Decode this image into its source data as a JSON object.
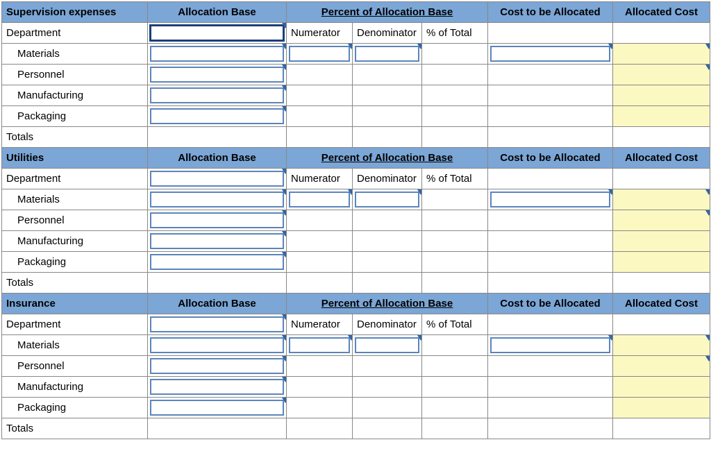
{
  "headers": {
    "allocation_base": "Allocation Base",
    "percent_alloc_base": "Percent of Allocation Base",
    "cost_to_be_allocated": "Cost to be Allocated",
    "allocated_cost": "Allocated Cost"
  },
  "sub_headers": {
    "department": "Department",
    "numerator": "Numerator",
    "denominator": "Denominator",
    "pct_of_total": "% of Total"
  },
  "row_labels": {
    "materials": "Materials",
    "personnel": "Personnel",
    "manufacturing": "Manufacturing",
    "packaging": "Packaging",
    "totals": "Totals"
  },
  "sections": [
    {
      "title": "Supervision expenses",
      "active_first_dropdown": true
    },
    {
      "title": "Utilities",
      "active_first_dropdown": false
    },
    {
      "title": "Insurance",
      "active_first_dropdown": false
    }
  ]
}
